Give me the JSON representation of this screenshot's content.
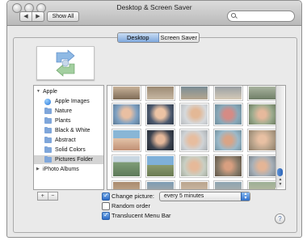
{
  "window": {
    "title": "Desktop & Screen Saver"
  },
  "toolbar": {
    "back": "◀",
    "forward": "▶",
    "show_all": "Show All",
    "search_placeholder": ""
  },
  "tabs": [
    {
      "label": "Desktop",
      "active": true
    },
    {
      "label": "Screen Saver",
      "active": false
    }
  ],
  "source_list": {
    "items": [
      {
        "label": "Apple",
        "type": "group",
        "expanded": true
      },
      {
        "label": "Apple Images",
        "type": "apple"
      },
      {
        "label": "Nature",
        "type": "folder"
      },
      {
        "label": "Plants",
        "type": "folder"
      },
      {
        "label": "Black & White",
        "type": "folder"
      },
      {
        "label": "Abstract",
        "type": "folder"
      },
      {
        "label": "Solid Colors",
        "type": "folder"
      },
      {
        "label": "Pictures Folder",
        "type": "folder",
        "selected": true
      },
      {
        "label": "iPhoto Albums",
        "type": "group",
        "expanded": false
      }
    ]
  },
  "list_buttons": {
    "add": "+",
    "remove": "−"
  },
  "options": {
    "change_picture": {
      "label": "Change picture:",
      "checked": true
    },
    "interval": {
      "selected": "every 5 minutes"
    },
    "random_order": {
      "label": "Random order",
      "checked": false
    },
    "translucent_menu_bar": {
      "label": "Translucent Menu Bar",
      "checked": true
    }
  },
  "help": {
    "label": "?"
  },
  "colors": {
    "accent": "#2d6cc8",
    "window_bg": "#e8e8e8"
  }
}
